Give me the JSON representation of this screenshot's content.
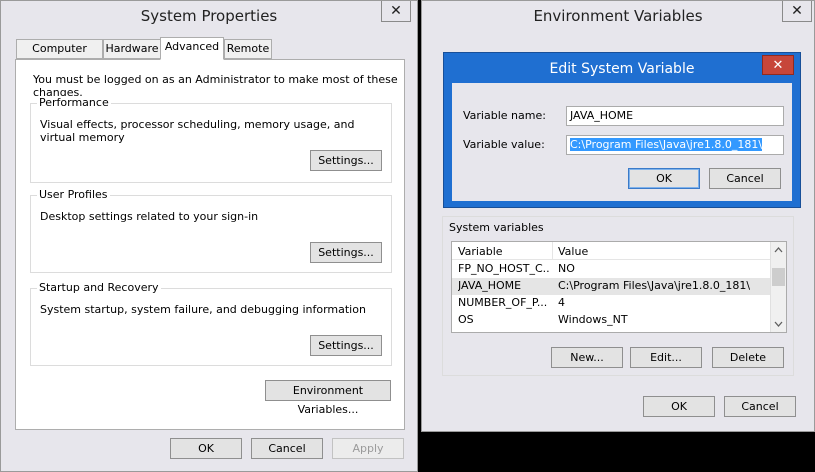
{
  "system_properties": {
    "title": "System Properties",
    "close_glyph": "✕",
    "tabs": [
      {
        "label": "Computer Name"
      },
      {
        "label": "Hardware"
      },
      {
        "label": "Advanced"
      },
      {
        "label": "Remote"
      }
    ],
    "admin_note": "You must be logged on as an Administrator to make most of these changes.",
    "performance": {
      "label": "Performance",
      "description": "Visual effects, processor scheduling, memory usage, and virtual memory",
      "button": "Settings..."
    },
    "user_profiles": {
      "label": "User Profiles",
      "description": "Desktop settings related to your sign-in",
      "button": "Settings..."
    },
    "startup_recovery": {
      "label": "Startup and Recovery",
      "description": "System startup, system failure, and debugging information",
      "button": "Settings..."
    },
    "env_vars_button": "Environment Variables...",
    "ok": "OK",
    "cancel": "Cancel",
    "apply": "Apply"
  },
  "environment_variables": {
    "title": "Environment Variables",
    "close_glyph": "✕",
    "system_variables_label": "System variables",
    "columns": [
      "Variable",
      "Value"
    ],
    "rows": [
      {
        "variable": "FP_NO_HOST_C...",
        "value": "NO"
      },
      {
        "variable": "JAVA_HOME",
        "value": "C:\\Program Files\\Java\\jre1.8.0_181\\"
      },
      {
        "variable": "NUMBER_OF_P...",
        "value": "4"
      },
      {
        "variable": "OS",
        "value": "Windows_NT"
      }
    ],
    "new_button": "New...",
    "edit_button": "Edit...",
    "delete_button": "Delete",
    "ok": "OK",
    "cancel": "Cancel"
  },
  "edit_dialog": {
    "title": "Edit System Variable",
    "close_glyph": "✕",
    "name_label": "Variable name:",
    "name_value": "JAVA_HOME",
    "value_label": "Variable value:",
    "value_value": "C:\\Program Files\\Java\\jre1.8.0_181\\",
    "ok": "OK",
    "cancel": "Cancel"
  },
  "colors": {
    "accent": "#3a7ac9",
    "dialog_frame": "#1f6fd1",
    "close_red": "#c7463a"
  }
}
